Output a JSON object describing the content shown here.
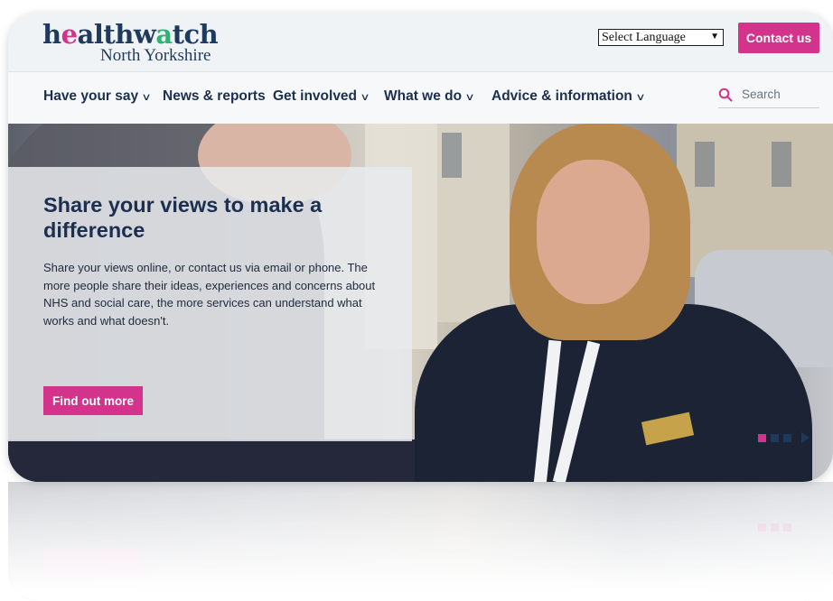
{
  "header": {
    "logo_text_part1": "h",
    "logo_text_dot": "e",
    "logo_text_part2": "althw",
    "logo_text_dot2": "a",
    "logo_text_part3": "tch",
    "logo_subtitle": "North Yorkshire",
    "language_select": "Select Language",
    "contact_label": "Contact us"
  },
  "nav": {
    "items": [
      {
        "label": "Have your say",
        "has_dropdown": true
      },
      {
        "label": "News & reports",
        "has_dropdown": false
      },
      {
        "label": "Get involved",
        "has_dropdown": true
      },
      {
        "label": "What we do",
        "has_dropdown": true
      },
      {
        "label": "Advice & information",
        "has_dropdown": true
      }
    ],
    "search_placeholder": "Search"
  },
  "hero": {
    "title": "Share your views to make a difference",
    "text": "Share your views online, or contact us via email or phone. The more people share their ideas, experiences and concerns about NHS and social care, the more services can understand what works and what doesn't.",
    "button_label": "Find out more",
    "slides": 3,
    "active_slide": 1
  },
  "colors": {
    "brand_navy": "#1c2f4f",
    "accent_pink": "#d4338b",
    "logo_green": "#2bb573"
  },
  "icons": {
    "search": "search-icon",
    "chevron": "chevron-down-icon",
    "next": "play-next-icon"
  }
}
